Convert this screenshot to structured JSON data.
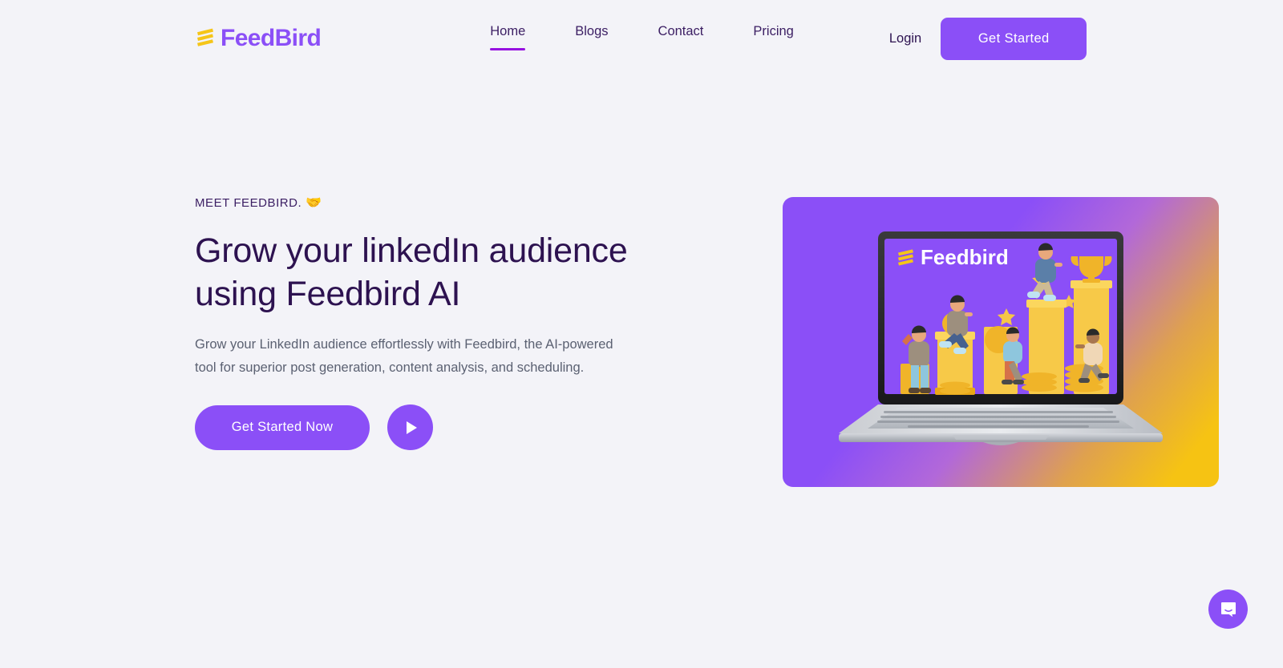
{
  "brand": {
    "name": "FeedBird",
    "mark_icon": "feedbird-stacked-bars-icon",
    "mark_color": "#f5c518",
    "text_color": "#8b4ff7"
  },
  "header": {
    "nav": [
      {
        "label": "Home",
        "active": true
      },
      {
        "label": "Blogs",
        "active": false
      },
      {
        "label": "Contact",
        "active": false
      },
      {
        "label": "Pricing",
        "active": false
      }
    ],
    "login_label": "Login",
    "get_started_label": "Get Started",
    "accent_color": "#8b4ff7",
    "active_underline_color": "#9611e0"
  },
  "hero": {
    "eyebrow": "MEET FEEDBIRD.",
    "eyebrow_emoji": "🤝",
    "title_line1": "Grow your linkedIn audience",
    "title_line2": "using Feedbird AI",
    "subtitle": "Grow your LinkedIn audience effortlessly with Feedbird, the AI-powered tool for superior post generation, content analysis, and scheduling.",
    "cta_label": "Get Started Now",
    "play_icon": "play-icon",
    "title_color": "#2d1250",
    "subtitle_color": "#5b6172"
  },
  "hero_visual": {
    "screen_brand": "Feedbird",
    "screen_bg": "#8b4ff7",
    "gradient_from": "#8b4ff7",
    "gradient_to": "#f6c313",
    "illustration": "people-climbing-gold-bar-chart-to-trophy",
    "device": "laptop"
  },
  "chat": {
    "icon": "chat-bubble-icon",
    "color": "#8b4ff7"
  },
  "page": {
    "background": "#f3f3f8"
  }
}
